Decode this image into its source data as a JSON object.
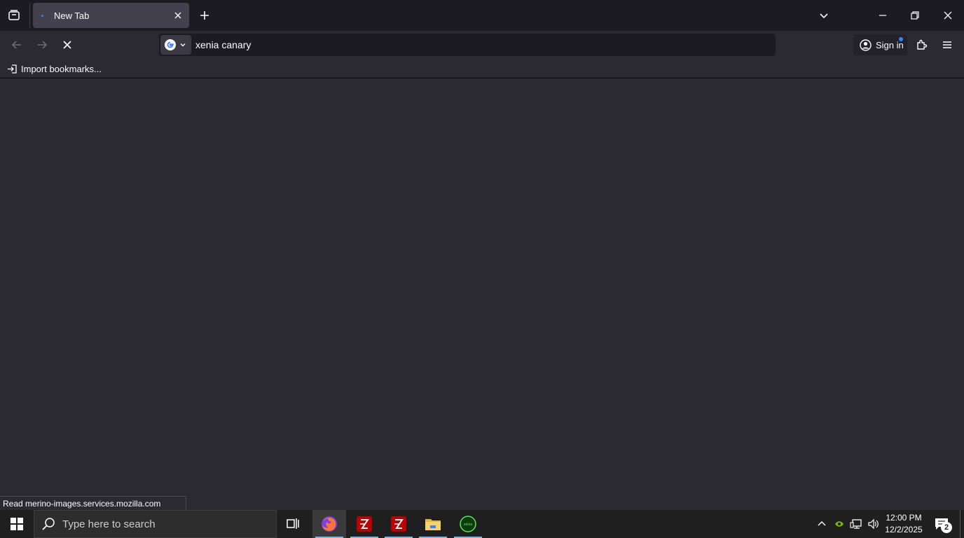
{
  "browser": {
    "tabs": [
      {
        "title": "New Tab",
        "active": true
      }
    ],
    "url_value": "xenia canary",
    "signin_label": "Sign in",
    "bookmarks": [
      {
        "label": "Import bookmarks..."
      }
    ],
    "status_text": "Read merino-images.services.mozilla.com"
  },
  "taskbar": {
    "search_placeholder": "Type here to search",
    "apps": [
      {
        "name": "task-view"
      },
      {
        "name": "firefox",
        "active": true
      },
      {
        "name": "filezilla"
      },
      {
        "name": "filezilla"
      },
      {
        "name": "file-explorer"
      },
      {
        "name": "xenia"
      }
    ],
    "clock_time": "12:00 PM",
    "clock_date": "12/2/2025",
    "notification_count": "2"
  },
  "colors": {
    "chrome_dark": "#1c1b22",
    "content_bg": "#2b2a33",
    "tab_active": "#42414d",
    "accent": "#3b82f6"
  }
}
